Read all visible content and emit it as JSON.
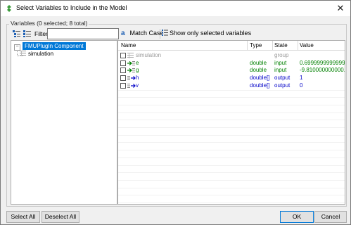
{
  "window": {
    "title": "Select Variables to Include in the Model",
    "close_glyph": "✕"
  },
  "group": {
    "title": "Variables (0 selected; 8 total)"
  },
  "toolbar": {
    "filter_label": "Filter:",
    "filter_value": "",
    "match_case_glyph": "a",
    "match_case_label": "Match Case",
    "show_selected_label": "Show only selected variables"
  },
  "tree": {
    "root": "FMUPlugIn Component",
    "expander_glyph": "−",
    "child": "simulation"
  },
  "table": {
    "columns": [
      "Name",
      "Type",
      "State",
      "Value"
    ],
    "rows": [
      {
        "name": "simulation",
        "type": "",
        "state": "group",
        "value": "",
        "color": "#9a9a9a",
        "icon": "group-icon"
      },
      {
        "name": "e",
        "type": "double",
        "state": "input",
        "value": "0.6999999999999...",
        "color": "#008000",
        "icon": "input-variable-icon"
      },
      {
        "name": "g",
        "type": "double",
        "state": "input",
        "value": "-9.810000000000...",
        "color": "#008000",
        "icon": "input-variable-icon"
      },
      {
        "name": "h",
        "type": "double[]",
        "state": "output",
        "value": "1",
        "color": "#0000c8",
        "icon": "output-variable-icon"
      },
      {
        "name": "v",
        "type": "double[]",
        "state": "output",
        "value": "0",
        "color": "#0000c8",
        "icon": "output-variable-icon"
      }
    ]
  },
  "buttons": {
    "select_all": "Select All",
    "deselect_all": "Deselect All",
    "ok": "OK",
    "cancel": "Cancel"
  },
  "colors": {
    "selection": "#0078d7",
    "input": "#008000",
    "output": "#0000c8",
    "group": "#9a9a9a"
  }
}
